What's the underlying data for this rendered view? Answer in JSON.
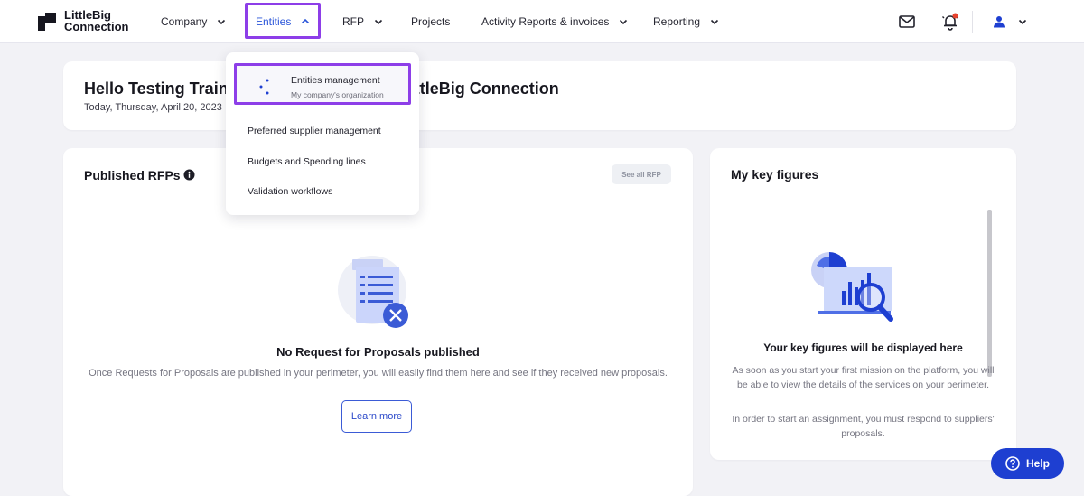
{
  "brand": {
    "line1": "LittleBig",
    "line2": "Connection"
  },
  "nav": {
    "items": [
      "Company",
      "Entities",
      "RFP",
      "Projects",
      "Activity Reports & invoices",
      "Reporting"
    ],
    "active": "Entities"
  },
  "topbar_icons": [
    "mail-icon",
    "bell-icon",
    "user-icon",
    "chevron-down-icon"
  ],
  "greeting": {
    "title_left": "Hello Testing Train",
    "title_right": "ttleBig Connection",
    "date": "Today, Thursday, April 20, 2023"
  },
  "dropdown": {
    "first_title": "Entities management",
    "first_subtitle": "My company's organization",
    "items": [
      "Preferred supplier management",
      "Budgets and Spending lines",
      "Validation workflows"
    ]
  },
  "rfps": {
    "title": "Published RFPs",
    "see_all": "See all RFP",
    "empty_title": "No Request for Proposals published",
    "empty_text": "Once Requests for Proposals are published in your perimeter, you will easily find them here and see if they received new proposals.",
    "learn_more": "Learn more"
  },
  "key_figures": {
    "title": "My key figures",
    "heading": "Your key figures will be displayed here",
    "text1": "As soon as you start your first mission on the platform, you will be able to view the details of the services on your perimeter.",
    "text2": "In order to start an assignment, you must respond to suppliers' proposals."
  },
  "help": {
    "label": "Help"
  },
  "colors": {
    "accent": "#1e3fd1",
    "highlight": "#8d3ee8",
    "notification": "#e8432e"
  }
}
